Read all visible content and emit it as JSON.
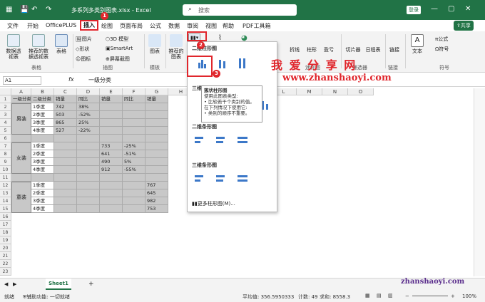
{
  "title_bar": {
    "file_name": "多系列多类别图表.xlsx - Excel",
    "search_placeholder": "搜索",
    "login_label": "登录",
    "save_icon": "save-icon",
    "undo_icon": "undo-icon",
    "redo_icon": "redo-icon"
  },
  "menu": {
    "items": [
      "文件",
      "开始",
      "OfficePLUS",
      "插入",
      "绘图",
      "页面布局",
      "公式",
      "数据",
      "审阅",
      "视图",
      "帮助",
      "PDF工具箱"
    ],
    "share_label": "共享"
  },
  "ribbon": {
    "table_group": {
      "btn1": "数据透视表",
      "btn2": "推荐的数据透视表",
      "btn3": "表格",
      "label": "表格"
    },
    "illust_group": {
      "pictures": "图片",
      "shapes": "形状",
      "icons": "图标",
      "models3d": "3D 模型",
      "smartart": "SmartArt",
      "screenshot": "屏幕截图",
      "label": "插图"
    },
    "addins": {
      "label1": "图表",
      "label2": "模板"
    },
    "charts": {
      "recommended": "推荐的图表"
    },
    "spark": {
      "line": "折线",
      "column": "柱形",
      "winloss": "盈亏",
      "label": "迷你图"
    },
    "filters": {
      "slicer": "切片器",
      "timeline": "日程表",
      "label": "筛选器"
    },
    "links": {
      "link": "链接",
      "label": "链接"
    },
    "text": {
      "text": "文本"
    },
    "symbols": {
      "equation": "公式",
      "symbol": "符号",
      "label": "符号"
    }
  },
  "formula_bar": {
    "name_box": "A1",
    "fx": "fx",
    "value": "一级分类"
  },
  "columns": [
    "A",
    "B",
    "C",
    "D",
    "E",
    "F",
    "G",
    "H",
    "I",
    "J",
    "K",
    "L",
    "M",
    "N",
    "O"
  ],
  "header_row": [
    "一级分类",
    "二级分类",
    "销量",
    "同比",
    "销量",
    "同比",
    "销量"
  ],
  "groups": [
    {
      "name": "男装",
      "quarters": [
        "1季度",
        "2季度",
        "3季度",
        "4季度"
      ],
      "sales": [
        "742",
        "503",
        "865",
        "527"
      ],
      "yoy": [
        "38%",
        "-52%",
        "25%",
        "-22%"
      ]
    },
    {
      "name": "女装",
      "quarters": [
        "1季度",
        "2季度",
        "3季度",
        "4季度"
      ],
      "sales": [
        "733",
        "641",
        "490",
        "912"
      ],
      "yoy": [
        "-25%",
        "-51%",
        "5%",
        "-55%"
      ]
    },
    {
      "name": "童装",
      "quarters": [
        "1季度",
        "2季度",
        "3季度",
        "4季度"
      ],
      "sales": [
        "767",
        "645",
        "982",
        "753"
      ]
    }
  ],
  "dropdown": {
    "sec1": "二维柱形图",
    "sec2": "三维柱形图",
    "sec3": "二维条形图",
    "sec4": "三维条形图",
    "more": "更多柱形图(M)..."
  },
  "tooltip": {
    "title": "簇状柱形图",
    "l1": "使用此图表类型:",
    "l2": "• 比较若干个类别的值。",
    "l3": "在下列情况下使用它:",
    "l4": "• 类别的顺序不重要。"
  },
  "markers": {
    "m1": "1",
    "m2": "2",
    "m3": "3"
  },
  "watermark": {
    "top": "我 爱 分 享 网",
    "url": "www.zhanshaoyi.com",
    "bottom": "zhanshaoyi.com"
  },
  "sheet": {
    "tab": "Sheet1",
    "add": "+"
  },
  "status": {
    "ready": "就绪",
    "access": "辅助功能: 一切就绪",
    "avg": "平均值: 356.5950333",
    "count": "计数: 49",
    "sum": "求和: 8558.3",
    "zoom": "100%"
  }
}
